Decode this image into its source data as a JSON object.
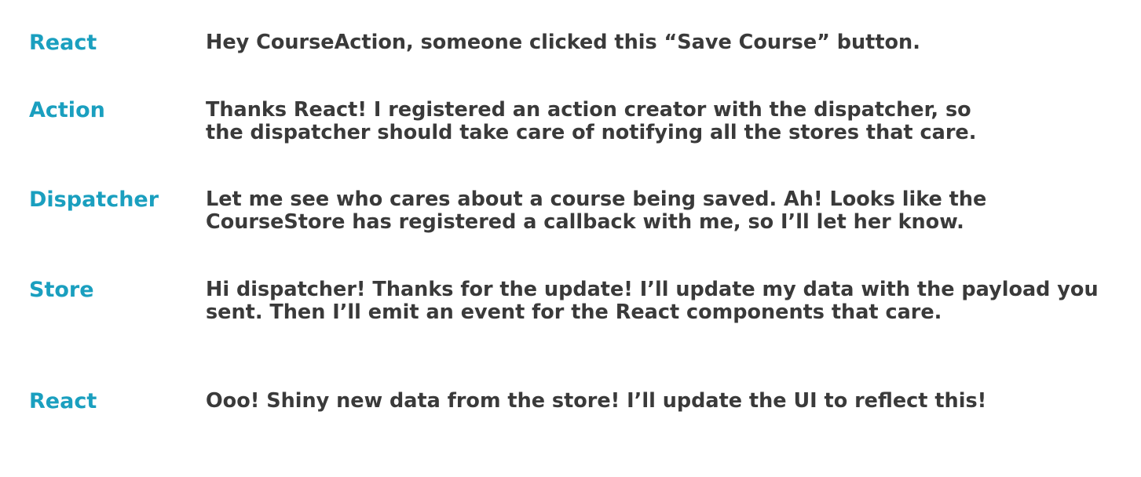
{
  "colors": {
    "speaker": "#1a9fbf",
    "text": "#3a3a3a",
    "background": "#ffffff"
  },
  "dialogue": [
    {
      "speaker": "React",
      "text": "Hey CourseAction, someone clicked this “Save Course” button."
    },
    {
      "speaker": "Action",
      "text": "Thanks React! I registered an action creator with the dispatcher, so\nthe dispatcher should take care of notifying all the stores that care."
    },
    {
      "speaker": "Dispatcher",
      "text": "Let me see who cares about a course being saved. Ah! Looks like the\nCourseStore has registered a callback with me, so I’ll let her know."
    },
    {
      "speaker": "Store",
      "text": "Hi dispatcher! Thanks for the update! I’ll update my data with the payload you\nsent. Then I’ll emit an event for the React components that care."
    },
    {
      "speaker": "React",
      "text": "Ooo! Shiny new data from the store! I’ll update the UI to reflect this!"
    }
  ]
}
